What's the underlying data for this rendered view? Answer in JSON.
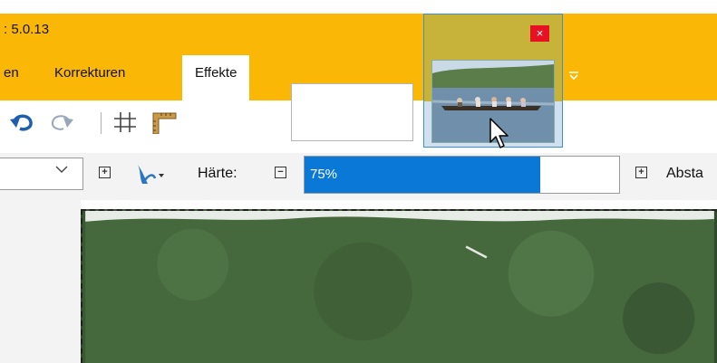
{
  "window": {
    "title": ": 5.0.13"
  },
  "menu": {
    "items": [
      {
        "label": "en"
      },
      {
        "label": "Korrekturen"
      },
      {
        "label": "Effekte"
      }
    ]
  },
  "thumbnail_popup": {
    "close_label": "×"
  },
  "options": {
    "hardness_label": "Härte:",
    "hardness_value": "75%",
    "hardness_percent": 75,
    "spacing_label": "Absta"
  },
  "colors": {
    "accent": "#fbb705",
    "selection": "#0a78d7",
    "close": "#e81123"
  },
  "icons": [
    "undo-icon",
    "redo-icon",
    "grid-icon",
    "ruler-icon",
    "brush-icon",
    "chevron-down-icon",
    "overflow-icon"
  ]
}
